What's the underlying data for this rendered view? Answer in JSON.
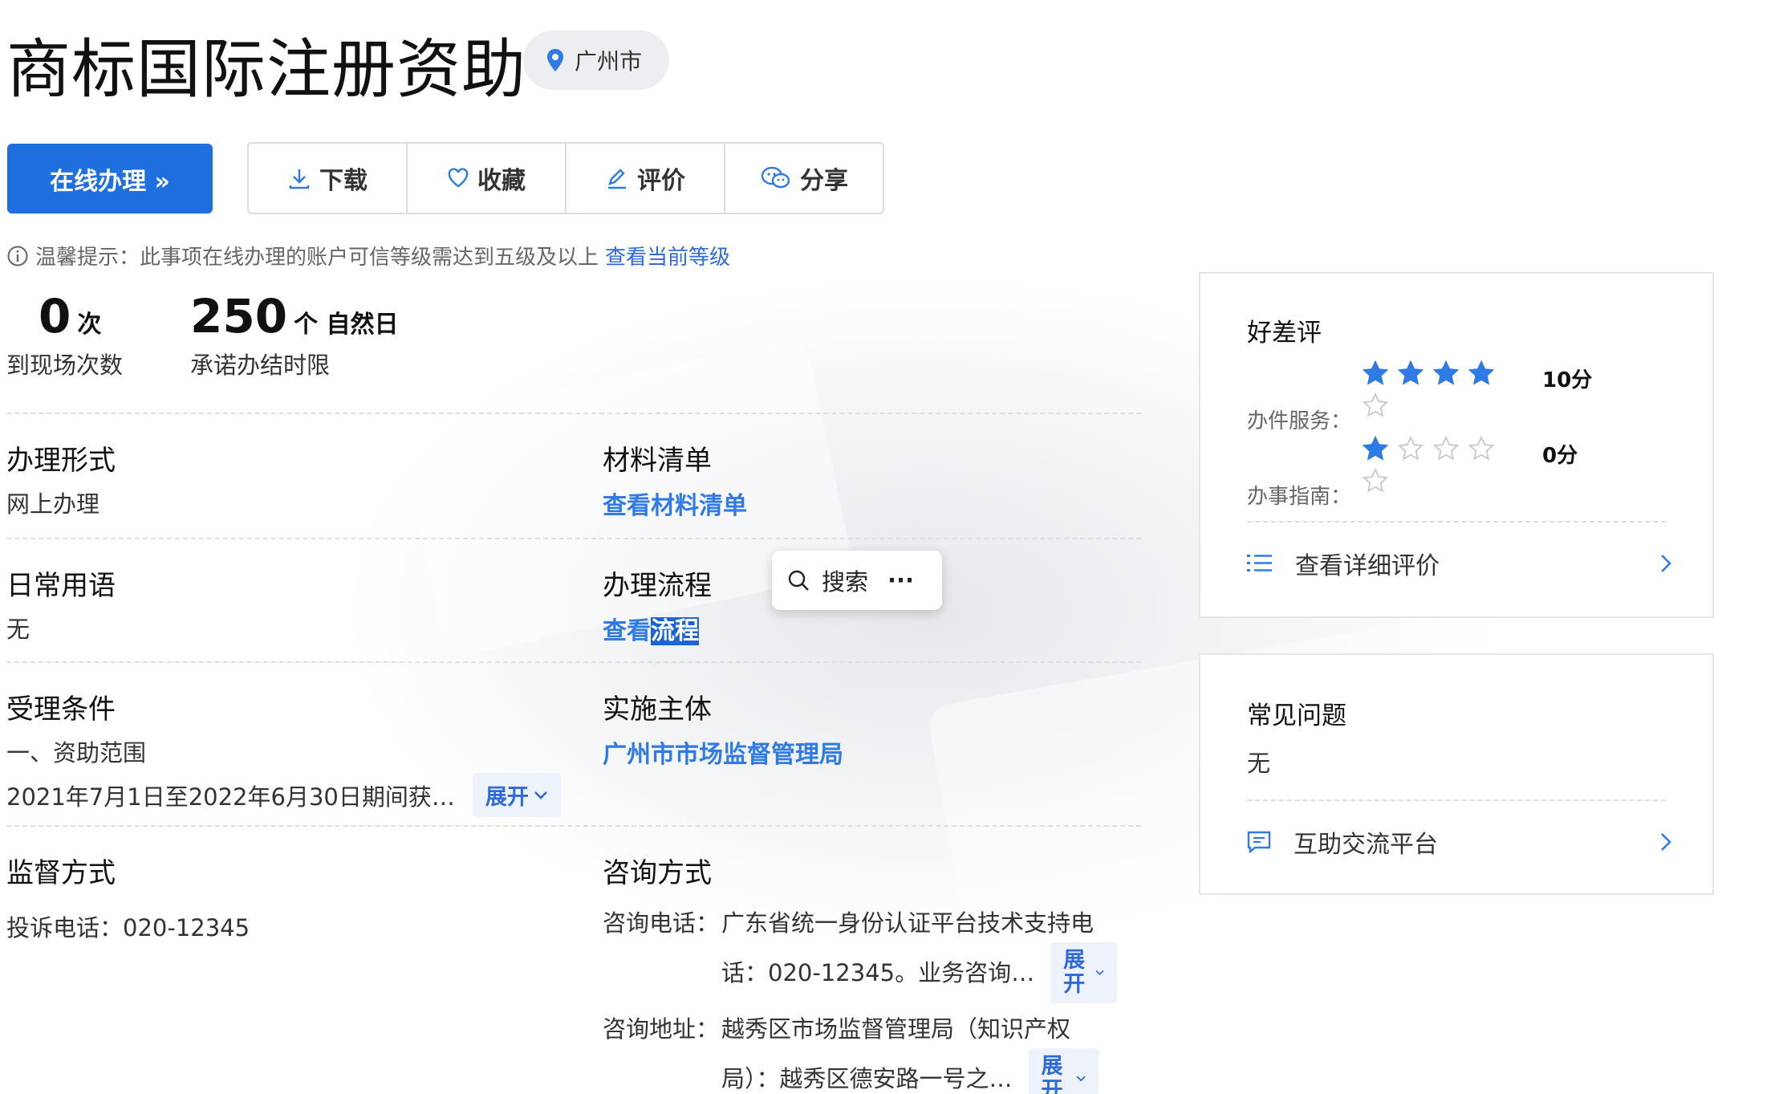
{
  "header": {
    "title": "商标国际注册资助",
    "location": "广州市"
  },
  "actions": {
    "online": "在线办理 »",
    "download": "下载",
    "favorite": "收藏",
    "rate": "评价",
    "share": "分享"
  },
  "tip": {
    "text": "温馨提示：此事项在线办理的账户可信等级需达到五级及以上",
    "link": "查看当前等级"
  },
  "stats": [
    {
      "num": "0",
      "unit": "次",
      "label": "到现场次数"
    },
    {
      "num": "250",
      "unit": "个 自然日",
      "label": "承诺办结时限"
    }
  ],
  "fields": {
    "mode": {
      "heading": "办理形式",
      "value": "网上办理"
    },
    "materials": {
      "heading": "材料清单",
      "link": "查看材料清单"
    },
    "terms": {
      "heading": "日常用语",
      "value": "无"
    },
    "process": {
      "heading": "办理流程",
      "link_a": "查看",
      "link_b": "流程"
    },
    "conditions": {
      "heading": "受理条件",
      "line1": "一、资助范围",
      "line2": "2021年7月1日至2022年6月30日期间获…"
    },
    "subject": {
      "heading": "实施主体",
      "link": "广州市市场监督管理局"
    },
    "supervision": {
      "heading": "监督方式",
      "value": "投诉电话：020-12345"
    },
    "consult": {
      "heading": "咨询方式",
      "phone_key": "咨询电话：",
      "phone_line1": "广东省统一身份认证平台技术支持电",
      "phone_line2": "话：020-12345。业务咨询…",
      "addr_key": "咨询地址：",
      "addr_line1": "越秀区市场监督管理局（知识产权",
      "addr_line2": "局）：越秀区德安路一号之…"
    }
  },
  "expand_label": "展开",
  "popup": {
    "search": "搜索",
    "more": "···"
  },
  "reviews": {
    "title": "好差评",
    "service": {
      "label": "办件服务：",
      "score": "10分",
      "stars_filled": 4,
      "stars_total": 5
    },
    "guide": {
      "label": "办事指南：",
      "score": "0分",
      "stars_filled": 1,
      "stars_total": 5
    },
    "detail_link": "查看详细评价"
  },
  "faq": {
    "title": "常见问题",
    "value": "无",
    "platform_link": "互助交流平台"
  },
  "colors": {
    "primary": "#1f6fe0",
    "link": "#2f7ae5",
    "star": "#2f7ae5"
  }
}
